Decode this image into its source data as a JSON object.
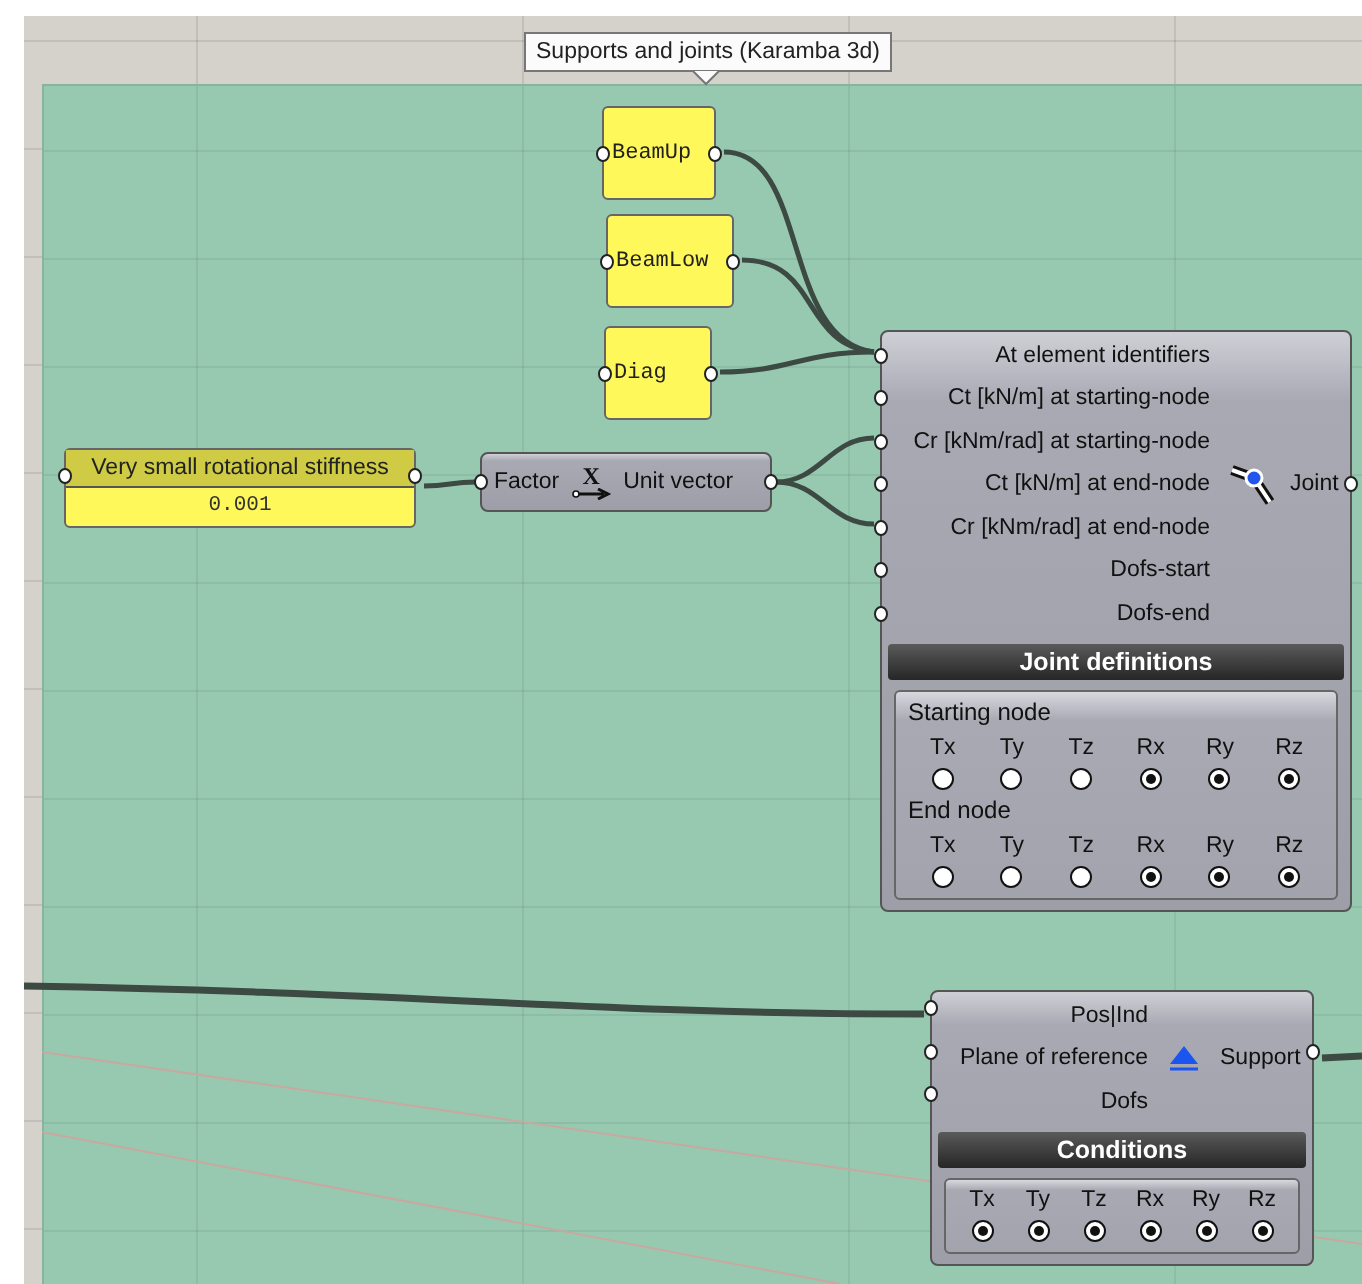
{
  "tooltip": "Supports and joints (Karamba 3d)",
  "params": [
    {
      "label": "BeamUp"
    },
    {
      "label": "BeamLow"
    },
    {
      "label": "Diag"
    }
  ],
  "slider": {
    "title": "Very small rotational stiffness",
    "value": "0.001"
  },
  "unit_vector": {
    "input": "Factor",
    "icon_letter": "X",
    "output": "Unit vector"
  },
  "joint": {
    "inputs": [
      "At element identifiers",
      "Ct [kN/m] at starting-node",
      "Cr [kNm/rad] at starting-node",
      "Ct [kN/m] at end-node",
      "Cr [kNm/rad] at end-node",
      "Dofs-start",
      "Dofs-end"
    ],
    "output": "Joint",
    "section_title": "Joint definitions",
    "groups": [
      {
        "title": "Starting node",
        "dofs": [
          {
            "label": "Tx",
            "checked": false
          },
          {
            "label": "Ty",
            "checked": false
          },
          {
            "label": "Tz",
            "checked": false
          },
          {
            "label": "Rx",
            "checked": true
          },
          {
            "label": "Ry",
            "checked": true
          },
          {
            "label": "Rz",
            "checked": true
          }
        ]
      },
      {
        "title": "End node",
        "dofs": [
          {
            "label": "Tx",
            "checked": false
          },
          {
            "label": "Ty",
            "checked": false
          },
          {
            "label": "Tz",
            "checked": false
          },
          {
            "label": "Rx",
            "checked": true
          },
          {
            "label": "Ry",
            "checked": true
          },
          {
            "label": "Rz",
            "checked": true
          }
        ]
      }
    ]
  },
  "support": {
    "inputs": [
      "Pos|Ind",
      "Plane of reference",
      "Dofs"
    ],
    "output": "Support",
    "section_title": "Conditions",
    "dofs": [
      {
        "label": "Tx",
        "checked": true
      },
      {
        "label": "Ty",
        "checked": true
      },
      {
        "label": "Tz",
        "checked": true
      },
      {
        "label": "Rx",
        "checked": true
      },
      {
        "label": "Ry",
        "checked": true
      },
      {
        "label": "Rz",
        "checked": true
      }
    ]
  }
}
